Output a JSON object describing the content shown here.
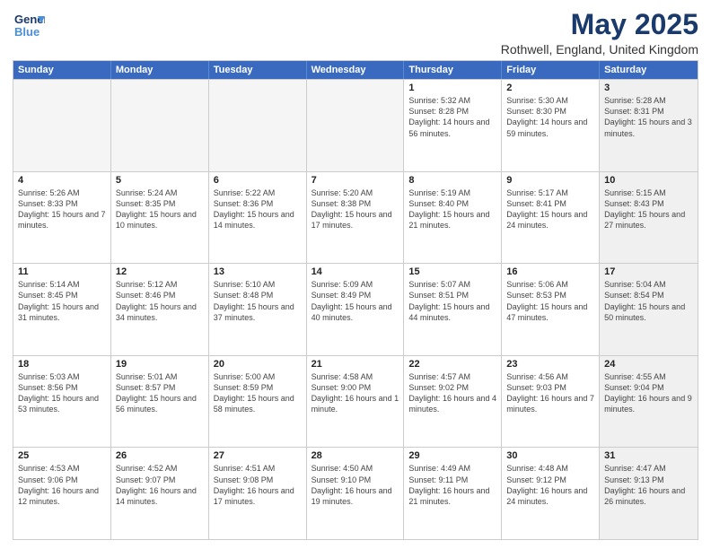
{
  "header": {
    "logo_line1": "General",
    "logo_line2": "Blue",
    "title": "May 2025",
    "subtitle": "Rothwell, England, United Kingdom"
  },
  "weekdays": [
    "Sunday",
    "Monday",
    "Tuesday",
    "Wednesday",
    "Thursday",
    "Friday",
    "Saturday"
  ],
  "rows": [
    [
      {
        "day": "",
        "empty": true
      },
      {
        "day": "",
        "empty": true
      },
      {
        "day": "",
        "empty": true
      },
      {
        "day": "",
        "empty": true
      },
      {
        "day": "1",
        "sunrise": "Sunrise: 5:32 AM",
        "sunset": "Sunset: 8:28 PM",
        "daylight": "Daylight: 14 hours and 56 minutes."
      },
      {
        "day": "2",
        "sunrise": "Sunrise: 5:30 AM",
        "sunset": "Sunset: 8:30 PM",
        "daylight": "Daylight: 14 hours and 59 minutes."
      },
      {
        "day": "3",
        "sunrise": "Sunrise: 5:28 AM",
        "sunset": "Sunset: 8:31 PM",
        "daylight": "Daylight: 15 hours and 3 minutes.",
        "shaded": true
      }
    ],
    [
      {
        "day": "4",
        "sunrise": "Sunrise: 5:26 AM",
        "sunset": "Sunset: 8:33 PM",
        "daylight": "Daylight: 15 hours and 7 minutes."
      },
      {
        "day": "5",
        "sunrise": "Sunrise: 5:24 AM",
        "sunset": "Sunset: 8:35 PM",
        "daylight": "Daylight: 15 hours and 10 minutes."
      },
      {
        "day": "6",
        "sunrise": "Sunrise: 5:22 AM",
        "sunset": "Sunset: 8:36 PM",
        "daylight": "Daylight: 15 hours and 14 minutes."
      },
      {
        "day": "7",
        "sunrise": "Sunrise: 5:20 AM",
        "sunset": "Sunset: 8:38 PM",
        "daylight": "Daylight: 15 hours and 17 minutes."
      },
      {
        "day": "8",
        "sunrise": "Sunrise: 5:19 AM",
        "sunset": "Sunset: 8:40 PM",
        "daylight": "Daylight: 15 hours and 21 minutes."
      },
      {
        "day": "9",
        "sunrise": "Sunrise: 5:17 AM",
        "sunset": "Sunset: 8:41 PM",
        "daylight": "Daylight: 15 hours and 24 minutes."
      },
      {
        "day": "10",
        "sunrise": "Sunrise: 5:15 AM",
        "sunset": "Sunset: 8:43 PM",
        "daylight": "Daylight: 15 hours and 27 minutes.",
        "shaded": true
      }
    ],
    [
      {
        "day": "11",
        "sunrise": "Sunrise: 5:14 AM",
        "sunset": "Sunset: 8:45 PM",
        "daylight": "Daylight: 15 hours and 31 minutes."
      },
      {
        "day": "12",
        "sunrise": "Sunrise: 5:12 AM",
        "sunset": "Sunset: 8:46 PM",
        "daylight": "Daylight: 15 hours and 34 minutes."
      },
      {
        "day": "13",
        "sunrise": "Sunrise: 5:10 AM",
        "sunset": "Sunset: 8:48 PM",
        "daylight": "Daylight: 15 hours and 37 minutes."
      },
      {
        "day": "14",
        "sunrise": "Sunrise: 5:09 AM",
        "sunset": "Sunset: 8:49 PM",
        "daylight": "Daylight: 15 hours and 40 minutes."
      },
      {
        "day": "15",
        "sunrise": "Sunrise: 5:07 AM",
        "sunset": "Sunset: 8:51 PM",
        "daylight": "Daylight: 15 hours and 44 minutes."
      },
      {
        "day": "16",
        "sunrise": "Sunrise: 5:06 AM",
        "sunset": "Sunset: 8:53 PM",
        "daylight": "Daylight: 15 hours and 47 minutes."
      },
      {
        "day": "17",
        "sunrise": "Sunrise: 5:04 AM",
        "sunset": "Sunset: 8:54 PM",
        "daylight": "Daylight: 15 hours and 50 minutes.",
        "shaded": true
      }
    ],
    [
      {
        "day": "18",
        "sunrise": "Sunrise: 5:03 AM",
        "sunset": "Sunset: 8:56 PM",
        "daylight": "Daylight: 15 hours and 53 minutes."
      },
      {
        "day": "19",
        "sunrise": "Sunrise: 5:01 AM",
        "sunset": "Sunset: 8:57 PM",
        "daylight": "Daylight: 15 hours and 56 minutes."
      },
      {
        "day": "20",
        "sunrise": "Sunrise: 5:00 AM",
        "sunset": "Sunset: 8:59 PM",
        "daylight": "Daylight: 15 hours and 58 minutes."
      },
      {
        "day": "21",
        "sunrise": "Sunrise: 4:58 AM",
        "sunset": "Sunset: 9:00 PM",
        "daylight": "Daylight: 16 hours and 1 minute."
      },
      {
        "day": "22",
        "sunrise": "Sunrise: 4:57 AM",
        "sunset": "Sunset: 9:02 PM",
        "daylight": "Daylight: 16 hours and 4 minutes."
      },
      {
        "day": "23",
        "sunrise": "Sunrise: 4:56 AM",
        "sunset": "Sunset: 9:03 PM",
        "daylight": "Daylight: 16 hours and 7 minutes."
      },
      {
        "day": "24",
        "sunrise": "Sunrise: 4:55 AM",
        "sunset": "Sunset: 9:04 PM",
        "daylight": "Daylight: 16 hours and 9 minutes.",
        "shaded": true
      }
    ],
    [
      {
        "day": "25",
        "sunrise": "Sunrise: 4:53 AM",
        "sunset": "Sunset: 9:06 PM",
        "daylight": "Daylight: 16 hours and 12 minutes."
      },
      {
        "day": "26",
        "sunrise": "Sunrise: 4:52 AM",
        "sunset": "Sunset: 9:07 PM",
        "daylight": "Daylight: 16 hours and 14 minutes."
      },
      {
        "day": "27",
        "sunrise": "Sunrise: 4:51 AM",
        "sunset": "Sunset: 9:08 PM",
        "daylight": "Daylight: 16 hours and 17 minutes."
      },
      {
        "day": "28",
        "sunrise": "Sunrise: 4:50 AM",
        "sunset": "Sunset: 9:10 PM",
        "daylight": "Daylight: 16 hours and 19 minutes."
      },
      {
        "day": "29",
        "sunrise": "Sunrise: 4:49 AM",
        "sunset": "Sunset: 9:11 PM",
        "daylight": "Daylight: 16 hours and 21 minutes."
      },
      {
        "day": "30",
        "sunrise": "Sunrise: 4:48 AM",
        "sunset": "Sunset: 9:12 PM",
        "daylight": "Daylight: 16 hours and 24 minutes."
      },
      {
        "day": "31",
        "sunrise": "Sunrise: 4:47 AM",
        "sunset": "Sunset: 9:13 PM",
        "daylight": "Daylight: 16 hours and 26 minutes.",
        "shaded": true
      }
    ]
  ]
}
